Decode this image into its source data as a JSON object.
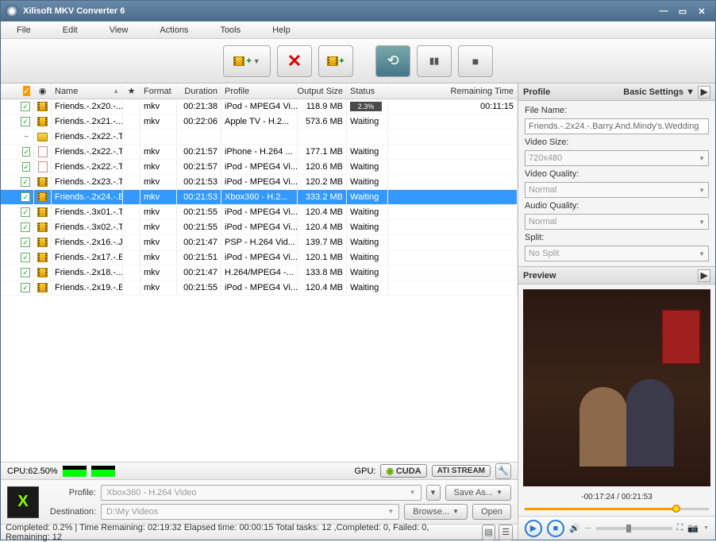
{
  "window": {
    "title": "Xilisoft MKV Converter 6"
  },
  "menu": [
    "File",
    "Edit",
    "View",
    "Actions",
    "Tools",
    "Help"
  ],
  "columns": {
    "check": "",
    "icon": "",
    "name": "Name",
    "star": "★",
    "format": "Format",
    "duration": "Duration",
    "profile": "Profile",
    "output_size": "Output Size",
    "status": "Status",
    "remaining": "Remaining Time"
  },
  "rows": [
    {
      "indent": 0,
      "exp": "",
      "checked": true,
      "icon": "film",
      "name": "Friends.-.2x20.-....",
      "format": "mkv",
      "duration": "00:21:38",
      "profile": "iPod - MPEG4 Vi...",
      "size": "118.9 MB",
      "status_type": "progress",
      "progress": "2.3%",
      "remaining": "00:11:15",
      "selected": false
    },
    {
      "indent": 0,
      "exp": "",
      "checked": true,
      "icon": "film",
      "name": "Friends.-.2x21.-....",
      "format": "mkv",
      "duration": "00:22:06",
      "profile": "Apple TV - H.2...",
      "size": "573.6 MB",
      "status_type": "text",
      "status": "Waiting",
      "remaining": "",
      "selected": false
    },
    {
      "indent": 0,
      "exp": "−",
      "checked": false,
      "icon": "folder",
      "name": "Friends.-.2x22.-.T...",
      "format": "",
      "duration": "",
      "profile": "",
      "size": "",
      "status_type": "none",
      "status": "",
      "remaining": "",
      "selected": false
    },
    {
      "indent": 1,
      "exp": "",
      "checked": true,
      "icon": "doc",
      "name": "Friends.-.2x22.-.T...",
      "format": "mkv",
      "duration": "00:21:57",
      "profile": "iPhone - H.264 ...",
      "size": "177.1 MB",
      "status_type": "text",
      "status": "Waiting",
      "remaining": "",
      "selected": false
    },
    {
      "indent": 1,
      "exp": "",
      "checked": true,
      "icon": "doc",
      "name": "Friends.-.2x22.-.T...",
      "format": "mkv",
      "duration": "00:21:57",
      "profile": "iPod - MPEG4 Vi...",
      "size": "120.6 MB",
      "status_type": "text",
      "status": "Waiting",
      "remaining": "",
      "selected": false
    },
    {
      "indent": 0,
      "exp": "",
      "checked": true,
      "icon": "film",
      "name": "Friends.-.2x23.-.T...",
      "format": "mkv",
      "duration": "00:21:53",
      "profile": "iPod - MPEG4 Vi...",
      "size": "120.2 MB",
      "status_type": "text",
      "status": "Waiting",
      "remaining": "",
      "selected": false
    },
    {
      "indent": 0,
      "exp": "",
      "checked": true,
      "icon": "film",
      "name": "Friends.-.2x24.-.B...",
      "format": "mkv",
      "duration": "00:21:53",
      "profile": "Xbox360 - H.2...",
      "size": "333.2 MB",
      "status_type": "text",
      "status": "Waiting",
      "remaining": "",
      "selected": true
    },
    {
      "indent": 0,
      "exp": "",
      "checked": true,
      "icon": "film",
      "name": "Friends.-.3x01.-.T...",
      "format": "mkv",
      "duration": "00:21:55",
      "profile": "iPod - MPEG4 Vi...",
      "size": "120.4 MB",
      "status_type": "text",
      "status": "Waiting",
      "remaining": "",
      "selected": false
    },
    {
      "indent": 0,
      "exp": "",
      "checked": true,
      "icon": "film",
      "name": "Friends.-.3x02.-.T...",
      "format": "mkv",
      "duration": "00:21:55",
      "profile": "iPod - MPEG4 Vi...",
      "size": "120.4 MB",
      "status_type": "text",
      "status": "Waiting",
      "remaining": "",
      "selected": false
    },
    {
      "indent": 0,
      "exp": "",
      "checked": true,
      "icon": "film",
      "name": "Friends.-.2x16.-.J...",
      "format": "mkv",
      "duration": "00:21:47",
      "profile": "PSP - H.264 Vid...",
      "size": "139.7 MB",
      "status_type": "text",
      "status": "Waiting",
      "remaining": "",
      "selected": false
    },
    {
      "indent": 0,
      "exp": "",
      "checked": true,
      "icon": "film",
      "name": "Friends.-.2x17.-.E...",
      "format": "mkv",
      "duration": "00:21:51",
      "profile": "iPod - MPEG4 Vi...",
      "size": "120.1 MB",
      "status_type": "text",
      "status": "Waiting",
      "remaining": "",
      "selected": false
    },
    {
      "indent": 0,
      "exp": "",
      "checked": true,
      "icon": "film",
      "name": "Friends.-.2x18.-....",
      "format": "mkv",
      "duration": "00:21:47",
      "profile": "H.264/MPEG4 -...",
      "size": "133.8 MB",
      "status_type": "text",
      "status": "Waiting",
      "remaining": "",
      "selected": false
    },
    {
      "indent": 0,
      "exp": "",
      "checked": true,
      "icon": "film",
      "name": "Friends.-.2x19.-.E...",
      "format": "mkv",
      "duration": "00:21:55",
      "profile": "iPod - MPEG4 Vi...",
      "size": "120.4 MB",
      "status_type": "text",
      "status": "Waiting",
      "remaining": "",
      "selected": false
    }
  ],
  "cpu": {
    "label": "CPU:62.50%"
  },
  "gpu": {
    "label": "GPU:",
    "cuda": "CUDA",
    "ati": "ATI STREAM"
  },
  "profile_section": {
    "profile_label": "Profile:",
    "profile_value": "Xbox360 - H.264 Video",
    "dest_label": "Destination:",
    "dest_value": "D:\\My Videos",
    "save_as": "Save As...",
    "browse": "Browse...",
    "open": "Open"
  },
  "status": "Completed: 0.2% | Time Remaining: 02:19:32 Elapsed time: 00:00:15 Total tasks: 12 ,Completed: 0, Failed: 0, Remaining: 12",
  "right": {
    "profile_title": "Profile",
    "basic": "Basic Settings ▼",
    "file_name_label": "File Name:",
    "file_name": "Friends.-.2x24.-.Barry.And.Mindy's.Wedding",
    "video_size_label": "Video Size:",
    "video_size": "720x480",
    "video_quality_label": "Video Quality:",
    "video_quality": "Normal",
    "audio_quality_label": "Audio Quality:",
    "audio_quality": "Normal",
    "split_label": "Split:",
    "split": "No Split",
    "preview_title": "Preview",
    "time": "-00:17:24 / 00:21:53"
  }
}
